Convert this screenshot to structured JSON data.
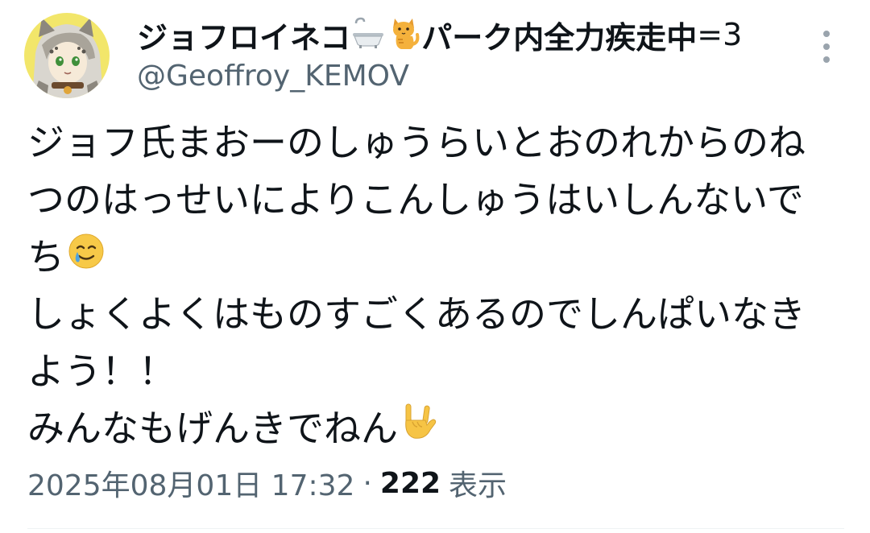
{
  "author": {
    "display_name_part1": "ジョフロイネコ",
    "display_name_part2": "パーク内全力疾走中",
    "display_name_suffix": "=3",
    "handle": "@Geoffroy_KEMOV",
    "name_icons": [
      "bathtub-icon",
      "cat-icon"
    ]
  },
  "tweet": {
    "lines": [
      "ジョフ氏まおーのしゅうらいとおのれからのね",
      "つのはっせいによりこんしゅうはいしんないで",
      "ち",
      "しょくよくはものすごくあるのでしんぱいなき",
      "よう！！",
      "みんなもげんきでねん"
    ],
    "inline_icons": [
      "smiling-face-with-tear-icon",
      "love-you-gesture-icon"
    ]
  },
  "meta": {
    "timestamp": "2025年08月01日 17:32",
    "separator": "·",
    "views_count": "222",
    "views_label": "表示"
  },
  "colors": {
    "text_primary": "#0f1419",
    "text_secondary": "#536471",
    "divider": "#eff3f4",
    "background": "#ffffff"
  }
}
